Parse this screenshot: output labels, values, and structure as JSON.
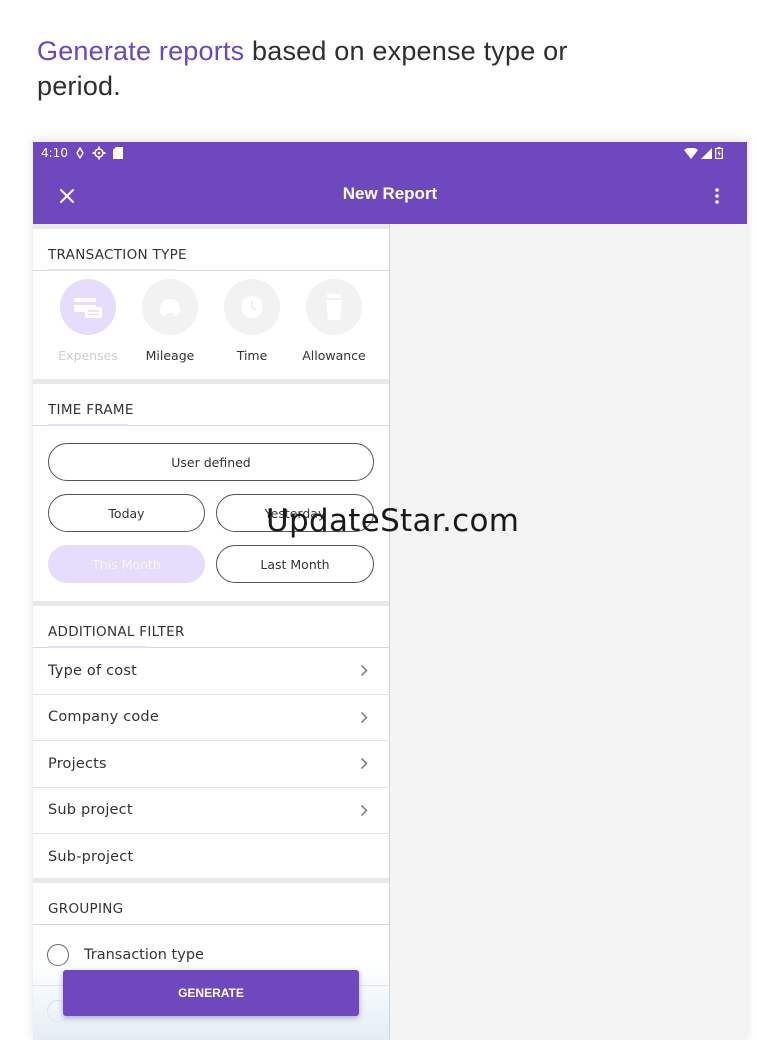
{
  "headline": {
    "accent": "Generate reports",
    "rest": " based on expense type or period."
  },
  "status_bar": {
    "time": "4:10"
  },
  "app_bar": {
    "title": "New Report"
  },
  "transaction_type": {
    "header": "TRANSACTION TYPE",
    "items": [
      {
        "label": "Expenses",
        "icon": "wallet-icon",
        "active": true
      },
      {
        "label": "Mileage",
        "icon": "car-icon",
        "active": false
      },
      {
        "label": "Time",
        "icon": "clock-icon",
        "active": false
      },
      {
        "label": "Allowance",
        "icon": "cup-icon",
        "active": false
      }
    ]
  },
  "time_frame": {
    "header": "TIME FRAME",
    "options": {
      "user_defined": "User defined",
      "today": "Today",
      "yesterday": "Yesterday",
      "this_month": "This Month",
      "last_month": "Last Month"
    },
    "selected": "This Month"
  },
  "additional_filter": {
    "header": "ADDITIONAL FILTER",
    "rows": [
      "Type of cost",
      "Company code",
      "Projects",
      "Sub project",
      "Sub-project"
    ]
  },
  "grouping": {
    "header": "GROUPING",
    "options": [
      "Transaction type"
    ]
  },
  "generate_label": "GENERATE",
  "watermark": "UpdateStar.com",
  "colors": {
    "primary": "#7048bd",
    "accent_light": "#e6dcfb",
    "headline_accent": "#6b46c1"
  }
}
